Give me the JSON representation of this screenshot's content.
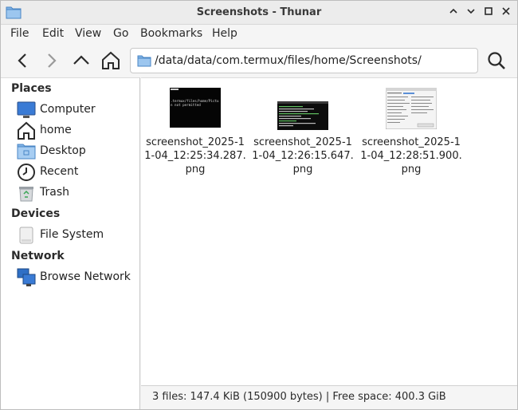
{
  "window": {
    "title": "Screenshots - Thunar",
    "controls": [
      "minimize",
      "maximize",
      "restore",
      "close"
    ]
  },
  "menubar": {
    "items": [
      "File",
      "Edit",
      "View",
      "Go",
      "Bookmarks",
      "Help"
    ]
  },
  "toolbar": {
    "location": "/data/data/com.termux/files/home/Screenshots/"
  },
  "sidebar": {
    "places_label": "Places",
    "places": [
      {
        "label": "Computer",
        "icon": "computer-icon"
      },
      {
        "label": "home",
        "icon": "home-icon"
      },
      {
        "label": "Desktop",
        "icon": "desktop-folder-icon"
      },
      {
        "label": "Recent",
        "icon": "clock-icon"
      },
      {
        "label": "Trash",
        "icon": "trash-icon"
      }
    ],
    "devices_label": "Devices",
    "devices": [
      {
        "label": "File System",
        "icon": "drive-icon"
      }
    ],
    "network_label": "Network",
    "network": [
      {
        "label": "Browse Network",
        "icon": "network-icon"
      }
    ]
  },
  "files": [
    {
      "line1": "screenshot_2025-1",
      "line2": "1-04_12:25:34.287.",
      "line3": "png",
      "thumb_text1": ".termux/files/home/Pictu",
      "thumb_text2": "n not permitted"
    },
    {
      "line1": "screenshot_2025-1",
      "line2": "1-04_12:26:15.647.",
      "line3": "png"
    },
    {
      "line1": "screenshot_2025-1",
      "line2": "1-04_12:28:51.900.",
      "line3": "png"
    }
  ],
  "status": {
    "text": "3 files: 147.4 KiB (150900 bytes)  |  Free space: 400.3 GiB"
  },
  "colors": {
    "folder_blue": "#5b9bd5",
    "accent": "#3c8dde"
  }
}
